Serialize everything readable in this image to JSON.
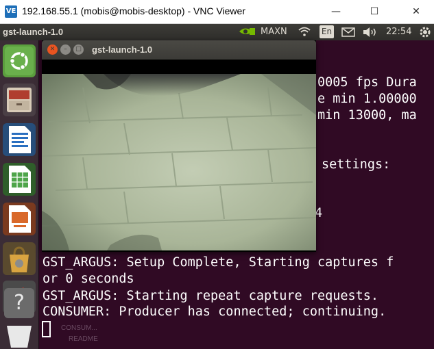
{
  "vnc": {
    "logo": "VE",
    "title": "192.168.55.1 (mobis@mobis-desktop) - VNC Viewer",
    "minimize_glyph": "—",
    "maximize_glyph": "☐",
    "close_glyph": "✕"
  },
  "panel": {
    "app_title": "gst-launch-1.0",
    "nvidia_label": "MAXN",
    "keyboard_layout": "En",
    "time": "22:54"
  },
  "terminal": {
    "lines": [
      "0005 fps Dura",
      "e min 1.00000",
      "min 13000, ma",
      "settings:",
      "4",
      "GST_ARGUS: Setup Complete, Starting captures f",
      "or 0 seconds",
      "GST_ARGUS: Starting repeat capture requests.",
      "CONSUMER: Producer has connected; continuing."
    ]
  },
  "desktop_icons": {
    "item1": "CONSUM...",
    "item2": "README"
  },
  "gst_window": {
    "title": "gst-launch-1.0",
    "close_glyph": "✕",
    "minimize_glyph": "–",
    "maximize_glyph": "□"
  },
  "icons": [
    "ubuntu-dash-icon",
    "files-icon",
    "writer-icon",
    "calc-icon",
    "impress-icon",
    "software-center-icon",
    "system-settings-icon",
    "help-icon",
    "nvidia-icon",
    "wifi-icon",
    "mail-icon",
    "volume-icon",
    "gear-icon"
  ],
  "colors": {
    "terminal_bg": "#300a24",
    "panel_bg": "#3c3b37",
    "ubuntu_orange": "#e95420",
    "nvidia_green": "#76b900"
  }
}
